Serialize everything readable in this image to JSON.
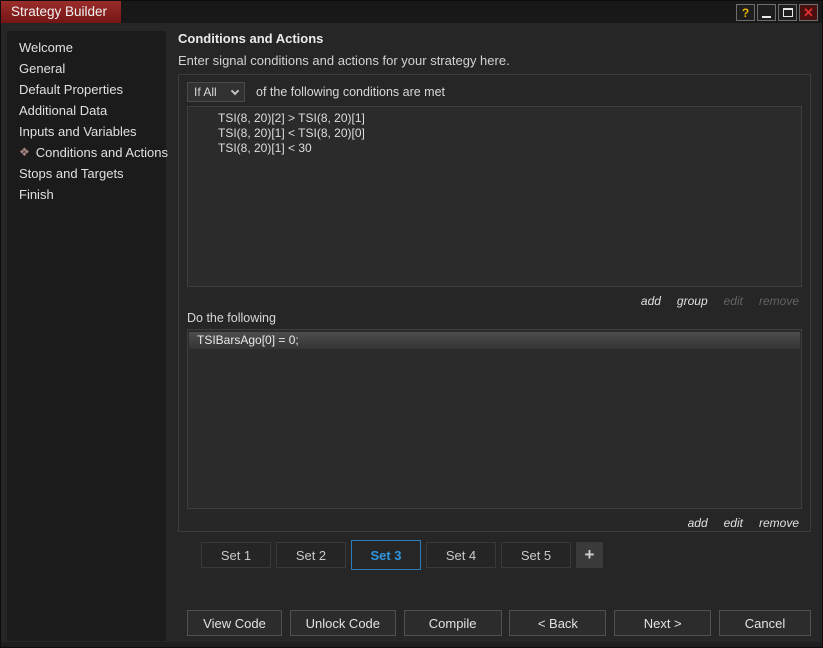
{
  "window": {
    "title": "Strategy Builder",
    "controls": {
      "help": "?",
      "close": "✕"
    }
  },
  "sidebar": {
    "selected_icon": "❖",
    "items": [
      {
        "label": "Welcome",
        "selected": false
      },
      {
        "label": "General",
        "selected": false
      },
      {
        "label": "Default Properties",
        "selected": false
      },
      {
        "label": "Additional Data",
        "selected": false
      },
      {
        "label": "Inputs and Variables",
        "selected": false
      },
      {
        "label": "Conditions and Actions",
        "selected": true
      },
      {
        "label": "Stops and Targets",
        "selected": false
      },
      {
        "label": "Finish",
        "selected": false
      }
    ]
  },
  "main": {
    "heading": "Conditions and Actions",
    "subtitle": "Enter signal conditions and actions for your strategy here.",
    "condition_builder": {
      "match_selector_value": "If All",
      "match_label": "of the following conditions are met",
      "conditions": [
        "TSI(8, 20)[2] > TSI(8, 20)[1]",
        "TSI(8, 20)[1] < TSI(8, 20)[0]",
        "TSI(8, 20)[1] < 30"
      ],
      "condition_links": [
        {
          "label": "add",
          "enabled": true
        },
        {
          "label": "group",
          "enabled": true
        },
        {
          "label": "edit",
          "enabled": false
        },
        {
          "label": "remove",
          "enabled": false
        }
      ],
      "actions_label": "Do the following",
      "actions": [
        "TSIBarsAgo[0] = 0;"
      ],
      "action_links": [
        {
          "label": "add",
          "enabled": true
        },
        {
          "label": "edit",
          "enabled": true
        },
        {
          "label": "remove",
          "enabled": true
        }
      ]
    },
    "set_tabs": [
      {
        "label": "Set 1",
        "active": false
      },
      {
        "label": "Set 2",
        "active": false
      },
      {
        "label": "Set 3",
        "active": true
      },
      {
        "label": "Set 4",
        "active": false
      },
      {
        "label": "Set 5",
        "active": false
      }
    ],
    "add_set_label": "+",
    "footer_buttons": [
      "View Code",
      "Unlock Code",
      "Compile",
      "< Back",
      "Next >",
      "Cancel"
    ]
  },
  "colors": {
    "title_tab_red": "#8a2422",
    "active_tab_blue": "#2f96e0",
    "background": "#262626",
    "sidebar_background": "#1b1b1b"
  }
}
